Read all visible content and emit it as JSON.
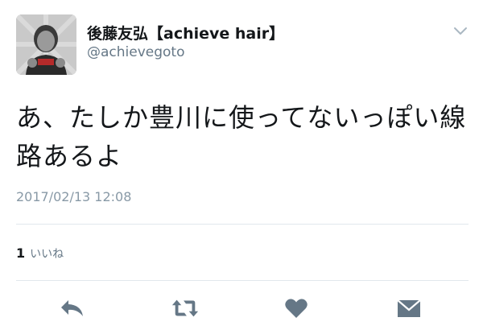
{
  "tweet": {
    "author": {
      "display_name": "後藤友弘【achieve hair】",
      "handle": "@achievegoto"
    },
    "text_line1": "あ、たしか豊川に使ってないっぽい線",
    "text_line2": "路あるよ",
    "timestamp": "2017/02/13 12:08",
    "likes": {
      "count": "1",
      "label": "いいね"
    }
  },
  "actions": [
    {
      "name": "reply",
      "icon": "reply-icon"
    },
    {
      "name": "retweet",
      "icon": "retweet-icon"
    },
    {
      "name": "like",
      "icon": "heart-icon"
    },
    {
      "name": "direct-message",
      "icon": "envelope-icon"
    }
  ],
  "colors": {
    "text": "#14171a",
    "secondary": "#657786",
    "icon": "#657786",
    "divider": "#e1e8ed"
  }
}
